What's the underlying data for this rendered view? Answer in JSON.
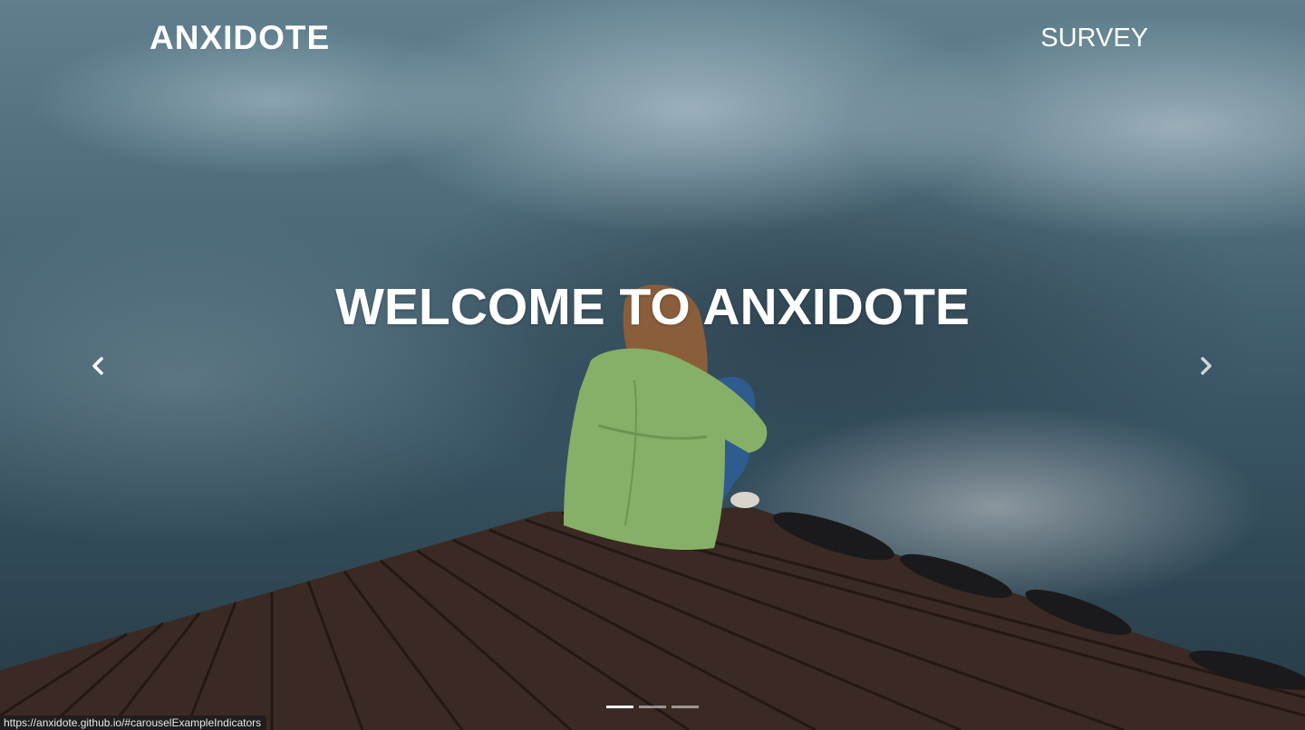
{
  "navbar": {
    "brand": "ANXIDOTE",
    "links": [
      {
        "label": "SURVEY"
      }
    ]
  },
  "carousel": {
    "caption": "WELCOME TO ANXIDOTE",
    "controls": {
      "prev_icon": "chevron-left-icon",
      "next_icon": "chevron-right-icon"
    },
    "indicators": [
      {
        "active": true
      },
      {
        "active": false
      },
      {
        "active": false
      }
    ],
    "background": "photo of a woman in a green jacket sitting on a wooden dock by a lake reflecting clouds"
  },
  "status_bar": {
    "url": "https://anxidote.github.io/#carouselExampleIndicators"
  },
  "colors": {
    "text": "#ffffff",
    "jacket": "#86b067",
    "dock": "#3b2a24",
    "water": "#3a5666"
  }
}
